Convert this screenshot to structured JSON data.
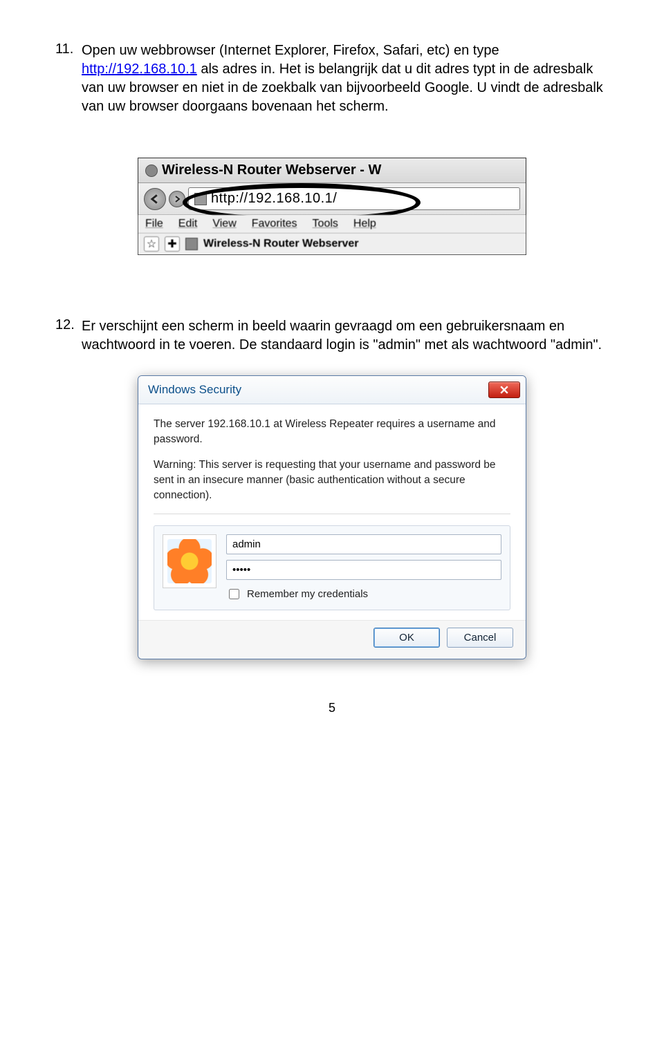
{
  "items": [
    {
      "num": "11.",
      "pre": "Open uw webbrowser (Internet Explorer, Firefox, Safari, etc) en type ",
      "link": "http://192.168.10.1",
      "post": " als adres in. Het is belangrijk dat u dit adres typt in de adresbalk van uw browser en niet in de zoekbalk van bijvoorbeeld Google. U vindt de adresbalk van uw browser doorgaans bovenaan het scherm."
    },
    {
      "num": "12.",
      "pre": "Er verschijnt een scherm in beeld waarin gevraagd om een gebruikersnaam en wachtwoord in te voeren. De standaard login is \"admin\" met als wachtwoord \"admin\".",
      "link": "",
      "post": ""
    }
  ],
  "browser": {
    "title": "Wireless-N Router Webserver - W",
    "url": "http://192.168.10.1/",
    "menu": [
      "File",
      "Edit",
      "View",
      "Favorites",
      "Tools",
      "Help"
    ],
    "tabTitle": "Wireless-N Router Webserver"
  },
  "dialog": {
    "title": "Windows Security",
    "line1": "The server 192.168.10.1 at Wireless Repeater requires a username and password.",
    "line2": "Warning: This server is requesting that your username and password be sent in an insecure manner (basic authentication without a secure connection).",
    "username": "admin",
    "passwordMasked": "•••••",
    "remember": "Remember my credentials",
    "ok": "OK",
    "cancel": "Cancel"
  },
  "pageNumber": "5"
}
